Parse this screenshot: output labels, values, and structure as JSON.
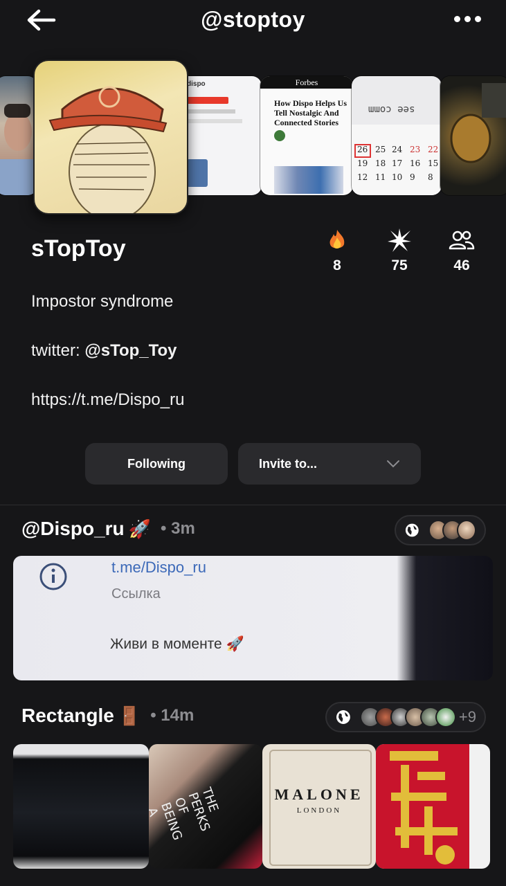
{
  "header": {
    "handle": "@stoptoy"
  },
  "profile": {
    "name": "sTopToy",
    "stats": [
      {
        "icon": "fire-icon",
        "value": "8"
      },
      {
        "icon": "sparkle-icon",
        "value": "75"
      },
      {
        "icon": "people-icon",
        "value": "46"
      }
    ],
    "bio_line1": "Impostor syndrome",
    "twitter_prefix": "twitter: ",
    "twitter_handle": "@sTop_Toy",
    "link": "https://t.me/Dispo_ru"
  },
  "banner": {
    "forbes_brand": "Forbes",
    "forbes_headline": "How Dispo Helps Us Tell Nostalgic And Connected Stories",
    "dispo_label": "dispo",
    "calendar_caption": "see comm"
  },
  "actions": {
    "following_label": "Following",
    "invite_label": "Invite to..."
  },
  "rolls": [
    {
      "title": "@Dispo_ru",
      "emoji": "🚀",
      "time": "3m",
      "preview_link": "t.me/Dispo_ru",
      "preview_sub": "Ссылка",
      "preview_text": "Живи в моменте"
    },
    {
      "title": "Rectangle",
      "emoji": "🚪",
      "time": "14m",
      "extra_count": "+9",
      "malone_title": "MALONE",
      "malone_sub": "LONDON",
      "book_title": "THE PERKS OF BEING A"
    }
  ],
  "colors": {
    "background": "#161618",
    "button": "#2a2a2d",
    "muted": "#8d8d91"
  }
}
